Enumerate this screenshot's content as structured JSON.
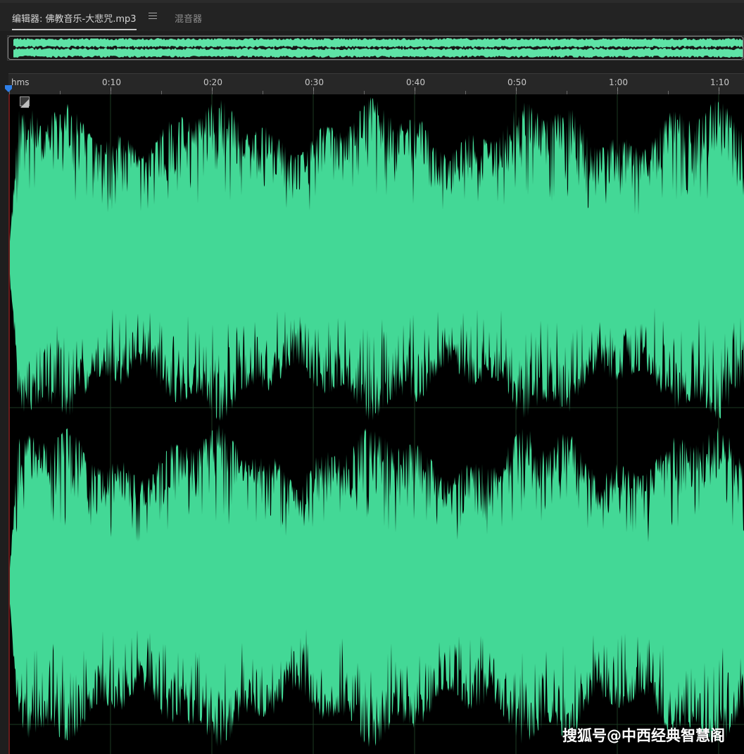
{
  "tabs": [
    {
      "label": "编辑器: 佛教音乐-大悲咒.mp3",
      "active": true
    },
    {
      "label": "混音器",
      "active": false
    }
  ],
  "tab_menu_icon": "hamburger-menu-icon",
  "ruler": {
    "unit_label": "hms",
    "labels": [
      "0:10",
      "0:20",
      "0:30",
      "0:40",
      "0:50",
      "1:00",
      "1:10"
    ]
  },
  "colors": {
    "waveform": "#43d896",
    "overview_waveform": "#5ee3a6",
    "background": "#000000",
    "playhead": "#2e7fe8"
  },
  "watermark": "搜狐号@中西经典智慧阁"
}
